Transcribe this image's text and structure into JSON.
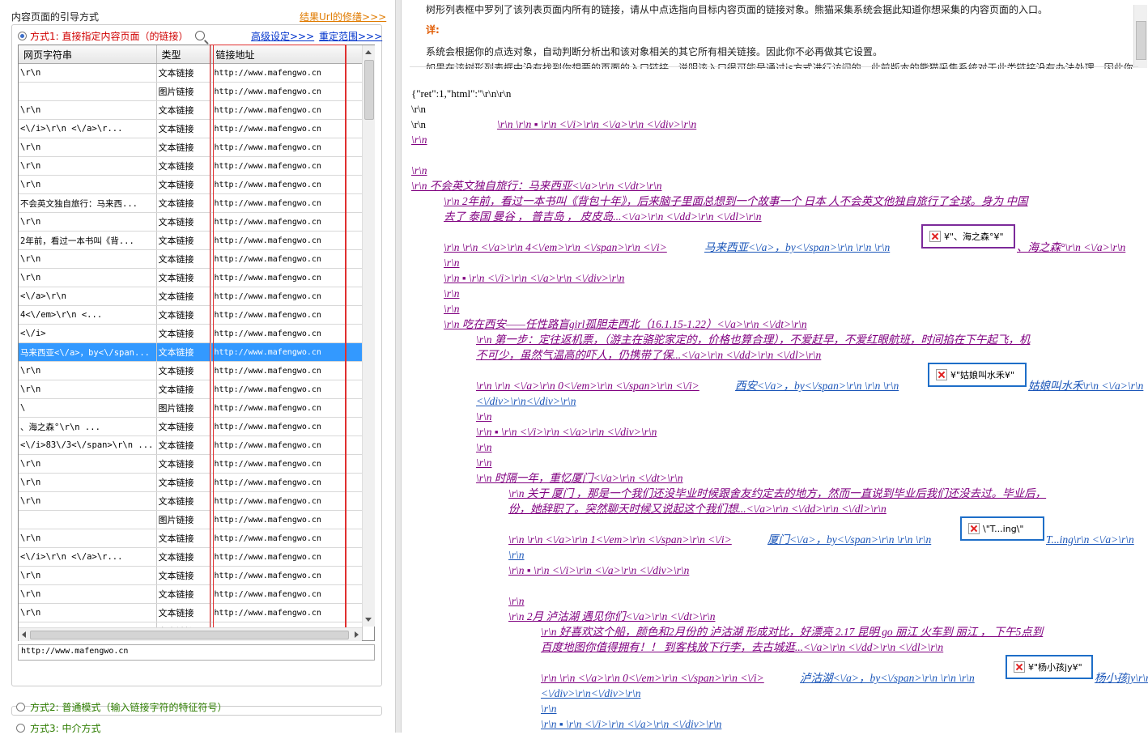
{
  "left": {
    "section_title": "内容页面的引导方式",
    "result_link": "结果Url的修缮>>>",
    "mode1_label": "方式1: 直接指定内容页面（的链接）",
    "advanced_link": "高级设定>>>",
    "reset_link": "重定范围>>>",
    "columns": [
      "网页字符串",
      "类型",
      "链接地址"
    ],
    "rows": [
      {
        "text": "\\r\\n",
        "type": "文本链接",
        "url": "http://www.mafengwo.cn"
      },
      {
        "text": "",
        "type": "图片链接",
        "url": "http://www.mafengwo.cn"
      },
      {
        "text": "\\r\\n",
        "type": "文本链接",
        "url": "http://www.mafengwo.cn"
      },
      {
        "text": "<\\/i>\\r\\n        <\\/a>\\r...",
        "type": "文本链接",
        "url": "http://www.mafengwo.cn"
      },
      {
        "text": "\\r\\n",
        "type": "文本链接",
        "url": "http://www.mafengwo.cn"
      },
      {
        "text": "\\r\\n",
        "type": "文本链接",
        "url": "http://www.mafengwo.cn"
      },
      {
        "text": "\\r\\n",
        "type": "文本链接",
        "url": "http://www.mafengwo.cn"
      },
      {
        "text": "不会英文独自旅行：马来西...",
        "type": "文本链接",
        "url": "http://www.mafengwo.cn"
      },
      {
        "text": "\\r\\n",
        "type": "文本链接",
        "url": "http://www.mafengwo.cn"
      },
      {
        "text": "2年前，看过一本书叫《背...",
        "type": "文本链接",
        "url": "http://www.mafengwo.cn"
      },
      {
        "text": "\\r\\n",
        "type": "文本链接",
        "url": "http://www.mafengwo.cn"
      },
      {
        "text": "\\r\\n",
        "type": "文本链接",
        "url": "http://www.mafengwo.cn"
      },
      {
        "text": "<\\/a>\\r\\n",
        "type": "文本链接",
        "url": "http://www.mafengwo.cn"
      },
      {
        "text": "4<\\/em>\\r\\n           <...",
        "type": "文本链接",
        "url": "http://www.mafengwo.cn"
      },
      {
        "text": "<\\/i>",
        "type": "文本链接",
        "url": "http://www.mafengwo.cn"
      },
      {
        "text": "马来西亚<\\/a>，by<\\/span...",
        "type": "文本链接",
        "url": "http://www.mafengwo.cn",
        "selected": true
      },
      {
        "text": "\\r\\n",
        "type": "文本链接",
        "url": "http://www.mafengwo.cn"
      },
      {
        "text": "\\r\\n",
        "type": "文本链接",
        "url": "http://www.mafengwo.cn"
      },
      {
        "text": "\\",
        "type": "图片链接",
        "url": "http://www.mafengwo.cn"
      },
      {
        "text": "、海之森°\\r\\n           ...",
        "type": "文本链接",
        "url": "http://www.mafengwo.cn"
      },
      {
        "text": "<\\/i>83\\/3<\\/span>\\r\\n   ...",
        "type": "文本链接",
        "url": "http://www.mafengwo.cn"
      },
      {
        "text": "\\r\\n",
        "type": "文本链接",
        "url": "http://www.mafengwo.cn"
      },
      {
        "text": "\\r\\n",
        "type": "文本链接",
        "url": "http://www.mafengwo.cn"
      },
      {
        "text": "\\r\\n",
        "type": "文本链接",
        "url": "http://www.mafengwo.cn"
      },
      {
        "text": "",
        "type": "图片链接",
        "url": "http://www.mafengwo.cn"
      },
      {
        "text": "\\r\\n",
        "type": "文本链接",
        "url": "http://www.mafengwo.cn"
      },
      {
        "text": "<\\/i>\\r\\n        <\\/a>\\r...",
        "type": "文本链接",
        "url": "http://www.mafengwo.cn"
      },
      {
        "text": "\\r\\n",
        "type": "文本链接",
        "url": "http://www.mafengwo.cn"
      },
      {
        "text": "\\r\\n",
        "type": "文本链接",
        "url": "http://www.mafengwo.cn"
      },
      {
        "text": "\\r\\n",
        "type": "文本链接",
        "url": "http://www.mafengwo.cn"
      },
      {
        "text": "吃在西安——任性路盲girl...",
        "type": "文本链接",
        "url": "http://www.mafengwo.cn"
      }
    ],
    "url_field": "http://www.mafengwo.cn",
    "mode2_label": "方式2: 普通模式（输入链接字符的特征符号）",
    "mode3_label": "方式3: 中介方式"
  },
  "right": {
    "desc_line1": "树形列表框中罗列了该列表页面内所有的链接，请从中点选指向目标内容页面的链接对象。熊猫采集系统会据此知道你想采集的内容页面的入口。",
    "desc_hint": "详:",
    "desc_line2": "系统会根据你的点选对象，自动判断分析出和该对象相关的其它所有相关链接。因此你不必再做其它设置。",
    "desc_line3": "如果在该树形列表框中没有找到你想要的页面的入口链接，说明该入口很可能是通过js方式进行访问的，此前版本的熊猫采集系统对于此类链接没有办法处理，因此你的",
    "code_lines": [
      "{\"ret\":1,\"html\":\"\\r\\n\\r\\n",
      "\\r\\n",
      "\\r\\n"
    ],
    "l1": "\\r\\n \\r\\n ▪ \\r\\n <\\/i>\\r\\n <\\/a>\\r\\n <\\/div>\\r\\n",
    "l2": "\\r\\n",
    "l3": "\\r\\n",
    "l4": "\\r\\n 不会英文独自旅行：马来西亚<\\/a>\\r\\n <\\/dt>\\r\\n",
    "l5": "\\r\\n 2年前，看过一本书叫《背包十年》，后来脑子里面总想到一个故事一个 日本 人不会英文他独自旅行了全球。身为 中国",
    "l6": "去了 泰国 曼谷 ， 普吉岛 ， 皮皮岛...<\\/a>\\r\\n <\\/dd>\\r\\n <\\/dl>\\r\\n",
    "l7a": "\\r\\n \\r\\n <\\/a>\\r\\n 4<\\/em>\\r\\n <\\/span>\\r\\n <\\/i>",
    "l7b": "马来西亚<\\/a>，by<\\/span>\\r\\n \\r\\n \\r\\n",
    "img1": "¥\"、海之森°¥\"",
    "l7c": "、海之森°\\r\\n <\\/a>\\r\\n",
    "l8": "\\r\\n",
    "l9": "\\r\\n ▪ \\r\\n <\\/i>\\r\\n <\\/a>\\r\\n <\\/div>\\r\\n",
    "l10": "\\r\\n",
    "l11": "\\r\\n",
    "l12": "\\r\\n 吃在西安——任性路盲girl孤胆走西北（16.1.15-1.22）<\\/a>\\r\\n <\\/dt>\\r\\n",
    "l13": "\\r\\n 第一步：定往返机票，（游主在骆驼家定的，价格也算合理），不爱赶早，不爱红眼航班，时间掐在下午起飞，机",
    "l14": "不可少，虽然气温高的吓人，仍携带了保...<\\/a>\\r\\n <\\/dd>\\r\\n <\\/dl>\\r\\n",
    "l15a": "\\r\\n \\r\\n <\\/a>\\r\\n 0<\\/em>\\r\\n <\\/span>\\r\\n <\\/i>",
    "l15b": "西安<\\/a>，by<\\/span>\\r\\n \\r\\n \\r\\n",
    "img2": "¥\"姑娘叫水禾¥\"",
    "l15c": "姑娘叫水禾\\r\\n <\\/a>\\r\\n",
    "l16": "<\\/div>\\r\\n<\\/div>\\r\\n",
    "l17": "\\r\\n",
    "l18": "\\r\\n ▪ \\r\\n <\\/i>\\r\\n <\\/a>\\r\\n <\\/div>\\r\\n",
    "l19": "\\r\\n",
    "l20": "\\r\\n",
    "l21": "\\r\\n 时隔一年，重忆厦门<\\/a>\\r\\n <\\/dt>\\r\\n",
    "l22": "\\r\\n 关于 厦门 ，那是一个我们还没毕业时候跟舍友约定去的地方，然而一直说到毕业后我们还没去过。毕业后，",
    "l23": "份，她辞职了。突然聊天时候又说起这个我们想...<\\/a>\\r\\n <\\/dd>\\r\\n <\\/dl>\\r\\n",
    "l24a": "\\r\\n \\r\\n <\\/a>\\r\\n 1<\\/em>\\r\\n <\\/span>\\r\\n <\\/i>",
    "l24b": "厦门<\\/a>，by<\\/span>\\r\\n \\r\\n \\r\\n",
    "img3": "\\\"T...ing\\\"",
    "l24c": "T...ing\\r\\n <\\/a>\\r\\n",
    "l25": "\\r\\n",
    "l26": "\\r\\n ▪ \\r\\n <\\/i>\\r\\n <\\/a>\\r\\n <\\/div>\\r\\n",
    "l27": "\\r\\n",
    "l28": "\\r\\n 2月 泸沽湖 遇见你们<\\/a>\\r\\n <\\/dt>\\r\\n",
    "l29": "\\r\\n 好喜欢这个船，颜色和2月份的 泸沽湖 形成对比，好漂亮 2.17 昆明 go 丽江 火车到 丽江 ， 下午5点到",
    "l30": "百度地图你值得拥有！！ 到客栈放下行李，去古城逛...<\\/a>\\r\\n <\\/dd>\\r\\n <\\/dl>\\r\\n",
    "l31a": "\\r\\n \\r\\n <\\/a>\\r\\n 0<\\/em>\\r\\n <\\/span>\\r\\n <\\/i>",
    "l31b": "泸沽湖<\\/a>，by<\\/span>\\r\\n \\r\\n \\r\\n",
    "img4": "¥\"杨小孩jy¥\"",
    "l31c": "杨小孩jy\\r\\n <\\/a>\\r\\n",
    "l32": "<\\/div>\\r\\n<\\/div>\\r\\n",
    "l33": "\\r\\n",
    "l34": "\\r\\n ▪ \\r\\n <\\/i>\\r\\n <\\/a>\\r\\n <\\/div>\\r\\n"
  }
}
